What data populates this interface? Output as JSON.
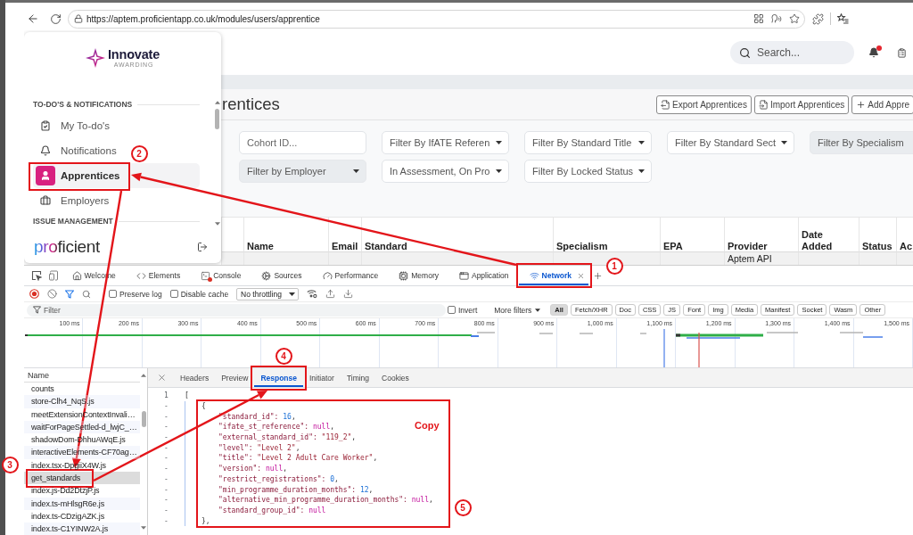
{
  "browser": {
    "url": "https://aptem.proficientapp.co.uk/modules/users/apprentice"
  },
  "app_header": {
    "search": {
      "placeholder": "Search..."
    },
    "notifications_unread": true
  },
  "sidebar": {
    "logo": {
      "name": "Innovate",
      "tagline": "AWARDING"
    },
    "sections": [
      {
        "title": "TO-DO'S & NOTIFICATIONS",
        "items": [
          {
            "label": "My To-do's",
            "selected": false
          },
          {
            "label": "Notifications",
            "selected": false
          },
          {
            "label": "Apprentices",
            "selected": true
          },
          {
            "label": "Employers",
            "selected": false
          }
        ]
      },
      {
        "title": "ISSUE MANAGEMENT"
      }
    ],
    "footer_brand": "proficient"
  },
  "page": {
    "title": "rentices",
    "actions": [
      "Export Apprentices",
      "Import Apprentices",
      "Add Appre"
    ],
    "filter_rows": [
      [
        {
          "kind": "input",
          "placeholder": "Cohort ID...",
          "disabled": false
        },
        {
          "kind": "dropdown",
          "label": "Filter By IfATE Referen",
          "disabled": false
        },
        {
          "kind": "dropdown",
          "label": "Filter By Standard Title",
          "disabled": false
        },
        {
          "kind": "dropdown",
          "label": "Filter By Standard Sect",
          "disabled": false
        },
        {
          "kind": "dropdown",
          "label": "Filter By Specialism",
          "disabled": true
        }
      ],
      [
        {
          "kind": "dropdown",
          "label": "Filter by Employer",
          "disabled": true
        },
        {
          "kind": "dropdown",
          "label": "In Assessment, On Pro",
          "disabled": false
        },
        {
          "kind": "dropdown",
          "label": "Filter By Locked Status",
          "disabled": false
        }
      ]
    ],
    "table": {
      "columns": [
        "Name",
        "Email",
        "Standard",
        "Specialism",
        "EPA",
        "Provider",
        "Date Added",
        "Status",
        "Ac"
      ],
      "rows": [
        {
          "provider": "Aptem API"
        }
      ]
    }
  },
  "devtools": {
    "tabs": [
      {
        "label": "Welcome",
        "selected": false
      },
      {
        "label": "Elements",
        "selected": false
      },
      {
        "label": "Console",
        "selected": false
      },
      {
        "label": "Sources",
        "selected": false
      },
      {
        "label": "Performance",
        "selected": false
      },
      {
        "label": "Memory",
        "selected": false
      },
      {
        "label": "Application",
        "selected": false
      },
      {
        "label": "Network",
        "selected": true
      }
    ],
    "toolbar": {
      "recording": true,
      "checkboxes": [
        {
          "label": "Preserve log",
          "checked": false
        },
        {
          "label": "Disable cache",
          "checked": false
        }
      ],
      "throttling": "No throttling"
    },
    "filter_bar": {
      "placeholder": "Filter",
      "invert": {
        "label": "Invert",
        "checked": false
      },
      "more_filters": "More filters",
      "types": [
        {
          "label": "All",
          "selected": true
        },
        {
          "label": "Fetch/XHR",
          "selected": false
        },
        {
          "label": "Doc",
          "selected": false
        },
        {
          "label": "CSS",
          "selected": false
        },
        {
          "label": "JS",
          "selected": false
        },
        {
          "label": "Font",
          "selected": false
        },
        {
          "label": "Img",
          "selected": false
        },
        {
          "label": "Media",
          "selected": false
        },
        {
          "label": "Manifest",
          "selected": false
        },
        {
          "label": "Socket",
          "selected": false
        },
        {
          "label": "Wasm",
          "selected": false
        },
        {
          "label": "Other",
          "selected": false
        }
      ]
    },
    "overview": {
      "ticks": [
        "100 ms",
        "200 ms",
        "300 ms",
        "400 ms",
        "500 ms",
        "600 ms",
        "700 ms",
        "800 ms",
        "900 ms",
        "1,000 ms",
        "1,100 ms",
        "1,200 ms",
        "1,300 ms",
        "1,400 ms",
        "1,500 ms"
      ]
    },
    "requests": {
      "header": "Name",
      "items": [
        {
          "name": "counts",
          "selected": false
        },
        {
          "name": "store-Clh4_NqS.js",
          "selected": false
        },
        {
          "name": "meetExtensionContextInvali…",
          "selected": false
        },
        {
          "name": "waitForPageSettled-d_lwjC_…",
          "selected": false
        },
        {
          "name": "shadowDom-DhhuAWqE.js",
          "selected": false
        },
        {
          "name": "interactiveElements-CF70ag…",
          "selected": false
        },
        {
          "name": "index.tsx-DpgiiX4W.js",
          "selected": false
        },
        {
          "name": "get_standards",
          "selected": true
        },
        {
          "name": "index.js-Dd2DtzjP.js",
          "selected": false
        },
        {
          "name": "index.ts-mHlsgR6e.js",
          "selected": false
        },
        {
          "name": "index.ts-CDzigAZK.js",
          "selected": false
        },
        {
          "name": "index.ts-C1YINW2A.js",
          "selected": false
        }
      ]
    },
    "detail": {
      "tabs": [
        {
          "label": "Headers",
          "selected": false
        },
        {
          "label": "Preview",
          "selected": false
        },
        {
          "label": "Response",
          "selected": true
        },
        {
          "label": "Initiator",
          "selected": false
        },
        {
          "label": "Timing",
          "selected": false
        },
        {
          "label": "Cookies",
          "selected": false
        }
      ],
      "response": {
        "lines": [
          {
            "gutter": "1",
            "kind": "bracket",
            "text": "[",
            "children": [
              {
                "gutter": "-",
                "kind": "bracket",
                "text": "{",
                "children": [
                  {
                    "gutter": "-",
                    "kind": "number",
                    "key": "\"standard_id\":",
                    "value": "16",
                    "end": ","
                  },
                  {
                    "gutter": "-",
                    "kind": "null",
                    "key": "\"ifate_st_reference\":",
                    "value": "null",
                    "end": ","
                  },
                  {
                    "gutter": "-",
                    "kind": "string",
                    "key": "\"external_standard_id\":",
                    "value": "\"119_2\"",
                    "end": ","
                  },
                  {
                    "gutter": "-",
                    "kind": "string",
                    "key": "\"level\":",
                    "value": "\"Level 2\"",
                    "end": ","
                  },
                  {
                    "gutter": "-",
                    "kind": "string",
                    "key": "\"title\":",
                    "value": "\"Level 2 Adult Care Worker\"",
                    "end": ","
                  },
                  {
                    "gutter": "-",
                    "kind": "null",
                    "key": "\"version\":",
                    "value": "null",
                    "end": ","
                  },
                  {
                    "gutter": "-",
                    "kind": "number",
                    "key": "\"restrict_registrations\":",
                    "value": "0",
                    "end": ","
                  },
                  {
                    "gutter": "-",
                    "kind": "number",
                    "key": "\"min_programme_duration_months\":",
                    "value": "12",
                    "end": ","
                  },
                  {
                    "gutter": "-",
                    "kind": "null",
                    "key": "\"alternative_min_programme_duration_months\":",
                    "value": "null",
                    "end": ","
                  },
                  {
                    "gutter": "-",
                    "kind": "null",
                    "key": "\"standard_group_id\":",
                    "value": "null"
                  }
                ]
              },
              {
                "gutter": "-",
                "kind": "bracket",
                "text": "},"
              }
            ]
          }
        ]
      }
    }
  },
  "annotations": {
    "steps": [
      "1",
      "2",
      "3",
      "4",
      "5"
    ],
    "note": "Copy"
  }
}
